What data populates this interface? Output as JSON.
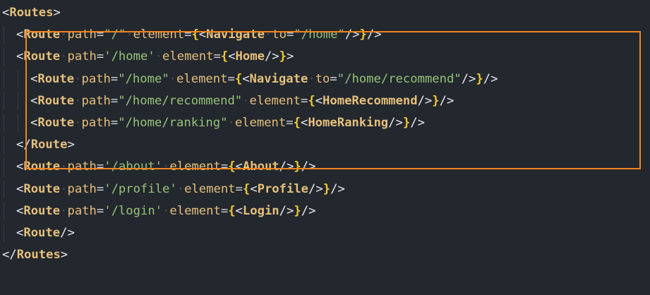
{
  "editor": {
    "highlight_color": "#f0851e",
    "lines": [
      {
        "indent": 0,
        "tokens": [
          {
            "t": "tag",
            "v": "<"
          },
          {
            "t": "comp",
            "v": "Routes"
          },
          {
            "t": "tag",
            "v": ">"
          }
        ]
      },
      {
        "indent": 1,
        "tokens": [
          {
            "t": "tag",
            "v": "<"
          },
          {
            "t": "comp",
            "v": "Route"
          },
          {
            "t": "ws",
            "v": "·"
          },
          {
            "t": "attr",
            "v": "path"
          },
          {
            "t": "eq",
            "v": "="
          },
          {
            "t": "string",
            "v": "\"/\""
          },
          {
            "t": "ws",
            "v": "·"
          },
          {
            "t": "attr",
            "v": "element"
          },
          {
            "t": "eq",
            "v": "="
          },
          {
            "t": "brace",
            "v": "{"
          },
          {
            "t": "tag",
            "v": "<"
          },
          {
            "t": "comp",
            "v": "Navigate"
          },
          {
            "t": "ws",
            "v": "·"
          },
          {
            "t": "attr",
            "v": "to"
          },
          {
            "t": "eq",
            "v": "="
          },
          {
            "t": "string",
            "v": "\"/home\""
          },
          {
            "t": "tag",
            "v": "/>"
          },
          {
            "t": "brace",
            "v": "}"
          },
          {
            "t": "tag",
            "v": "/>"
          }
        ]
      },
      {
        "indent": 1,
        "tokens": [
          {
            "t": "tag",
            "v": "<"
          },
          {
            "t": "comp",
            "v": "Route"
          },
          {
            "t": "ws",
            "v": "·"
          },
          {
            "t": "attr",
            "v": "path"
          },
          {
            "t": "eq",
            "v": "="
          },
          {
            "t": "string",
            "v": "'/home'"
          },
          {
            "t": "ws",
            "v": "·"
          },
          {
            "t": "attr",
            "v": "element"
          },
          {
            "t": "eq",
            "v": "="
          },
          {
            "t": "brace",
            "v": "{"
          },
          {
            "t": "tag",
            "v": "<"
          },
          {
            "t": "comp",
            "v": "Home"
          },
          {
            "t": "tag",
            "v": "/>"
          },
          {
            "t": "brace",
            "v": "}"
          },
          {
            "t": "tag",
            "v": ">"
          }
        ]
      },
      {
        "indent": 2,
        "tokens": [
          {
            "t": "tag",
            "v": "<"
          },
          {
            "t": "comp",
            "v": "Route"
          },
          {
            "t": "ws",
            "v": "·"
          },
          {
            "t": "attr",
            "v": "path"
          },
          {
            "t": "eq",
            "v": "="
          },
          {
            "t": "string",
            "v": "\"/home\""
          },
          {
            "t": "ws",
            "v": "·"
          },
          {
            "t": "attr",
            "v": "element"
          },
          {
            "t": "eq",
            "v": "="
          },
          {
            "t": "brace",
            "v": "{"
          },
          {
            "t": "tag",
            "v": "<"
          },
          {
            "t": "comp",
            "v": "Navigate"
          },
          {
            "t": "ws",
            "v": "·"
          },
          {
            "t": "attr",
            "v": "to"
          },
          {
            "t": "eq",
            "v": "="
          },
          {
            "t": "string",
            "v": "\"/home/recommend\""
          },
          {
            "t": "tag",
            "v": "/>"
          },
          {
            "t": "brace",
            "v": "}"
          },
          {
            "t": "tag",
            "v": "/>"
          }
        ]
      },
      {
        "indent": 2,
        "tokens": [
          {
            "t": "tag",
            "v": "<"
          },
          {
            "t": "comp",
            "v": "Route"
          },
          {
            "t": "ws",
            "v": "·"
          },
          {
            "t": "attr",
            "v": "path"
          },
          {
            "t": "eq",
            "v": "="
          },
          {
            "t": "string",
            "v": "\"/home/recommend\""
          },
          {
            "t": "ws",
            "v": "·"
          },
          {
            "t": "attr",
            "v": "element"
          },
          {
            "t": "eq",
            "v": "="
          },
          {
            "t": "brace",
            "v": "{"
          },
          {
            "t": "tag",
            "v": "<"
          },
          {
            "t": "comp",
            "v": "HomeRecommend"
          },
          {
            "t": "tag",
            "v": "/>"
          },
          {
            "t": "brace",
            "v": "}"
          },
          {
            "t": "tag",
            "v": "/>"
          }
        ]
      },
      {
        "indent": 2,
        "tokens": [
          {
            "t": "tag",
            "v": "<"
          },
          {
            "t": "comp",
            "v": "Route"
          },
          {
            "t": "ws",
            "v": "·"
          },
          {
            "t": "attr",
            "v": "path"
          },
          {
            "t": "eq",
            "v": "="
          },
          {
            "t": "string",
            "v": "\"/home/ranking\""
          },
          {
            "t": "ws",
            "v": "·"
          },
          {
            "t": "attr",
            "v": "element"
          },
          {
            "t": "eq",
            "v": "="
          },
          {
            "t": "brace",
            "v": "{"
          },
          {
            "t": "tag",
            "v": "<"
          },
          {
            "t": "comp",
            "v": "HomeRanking"
          },
          {
            "t": "tag",
            "v": "/>"
          },
          {
            "t": "brace",
            "v": "}"
          },
          {
            "t": "tag",
            "v": "/>"
          }
        ]
      },
      {
        "indent": 1,
        "tokens": [
          {
            "t": "tag",
            "v": "</"
          },
          {
            "t": "comp",
            "v": "Route"
          },
          {
            "t": "tag",
            "v": ">"
          }
        ]
      },
      {
        "indent": 1,
        "tokens": [
          {
            "t": "tag",
            "v": "<"
          },
          {
            "t": "comp",
            "v": "Route"
          },
          {
            "t": "ws",
            "v": "·"
          },
          {
            "t": "attr",
            "v": "path"
          },
          {
            "t": "eq",
            "v": "="
          },
          {
            "t": "string",
            "v": "'/about'"
          },
          {
            "t": "ws",
            "v": "·"
          },
          {
            "t": "attr",
            "v": "element"
          },
          {
            "t": "eq",
            "v": "="
          },
          {
            "t": "brace",
            "v": "{"
          },
          {
            "t": "tag",
            "v": "<"
          },
          {
            "t": "comp",
            "v": "About"
          },
          {
            "t": "tag",
            "v": "/>"
          },
          {
            "t": "brace",
            "v": "}"
          },
          {
            "t": "tag",
            "v": "/>"
          }
        ]
      },
      {
        "indent": 1,
        "tokens": [
          {
            "t": "tag",
            "v": "<"
          },
          {
            "t": "comp",
            "v": "Route"
          },
          {
            "t": "ws",
            "v": "·"
          },
          {
            "t": "attr",
            "v": "path"
          },
          {
            "t": "eq",
            "v": "="
          },
          {
            "t": "string",
            "v": "'/profile'"
          },
          {
            "t": "ws",
            "v": "·"
          },
          {
            "t": "attr",
            "v": "element"
          },
          {
            "t": "eq",
            "v": "="
          },
          {
            "t": "brace",
            "v": "{"
          },
          {
            "t": "tag",
            "v": "<"
          },
          {
            "t": "comp",
            "v": "Profile"
          },
          {
            "t": "tag",
            "v": "/>"
          },
          {
            "t": "brace",
            "v": "}"
          },
          {
            "t": "tag",
            "v": "/>"
          }
        ]
      },
      {
        "indent": 1,
        "tokens": [
          {
            "t": "tag",
            "v": "<"
          },
          {
            "t": "comp",
            "v": "Route"
          },
          {
            "t": "ws",
            "v": "·"
          },
          {
            "t": "attr",
            "v": "path"
          },
          {
            "t": "eq",
            "v": "="
          },
          {
            "t": "string",
            "v": "'/login'"
          },
          {
            "t": "ws",
            "v": "·"
          },
          {
            "t": "attr",
            "v": "element"
          },
          {
            "t": "eq",
            "v": "="
          },
          {
            "t": "brace",
            "v": "{"
          },
          {
            "t": "tag",
            "v": "<"
          },
          {
            "t": "comp",
            "v": "Login"
          },
          {
            "t": "tag",
            "v": "/>"
          },
          {
            "t": "brace",
            "v": "}"
          },
          {
            "t": "tag",
            "v": "/>"
          }
        ]
      },
      {
        "indent": 1,
        "tokens": [
          {
            "t": "tag",
            "v": "<"
          },
          {
            "t": "comp",
            "v": "Route"
          },
          {
            "t": "tag",
            "v": "/>"
          }
        ]
      },
      {
        "indent": 0,
        "tokens": [
          {
            "t": "tag",
            "v": "</"
          },
          {
            "t": "comp",
            "v": "Routes"
          },
          {
            "t": "tag",
            "v": ">"
          }
        ]
      }
    ]
  }
}
